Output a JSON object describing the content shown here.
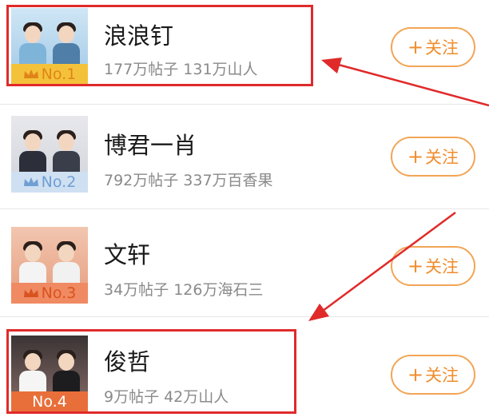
{
  "follow_label": "关注",
  "follow_plus": "+",
  "items": [
    {
      "name": "浪浪钉",
      "posts": "177万帖子",
      "followers": "131万山人",
      "rank": "No.1",
      "rank_color": "#f0a020",
      "highlighted": true
    },
    {
      "name": "博君一肖",
      "posts": "792万帖子",
      "followers": "337万百香果",
      "rank": "No.2",
      "rank_color": "#7aa6d8",
      "highlighted": false
    },
    {
      "name": "文轩",
      "posts": "34万帖子",
      "followers": "126万海石三",
      "rank": "No.3",
      "rank_color": "#e8734a",
      "highlighted": false
    },
    {
      "name": "俊哲",
      "posts": "9万帖子",
      "followers": "42万山人",
      "rank": "No.4",
      "rank_color": "#e86f3a",
      "highlighted": true
    }
  ],
  "colors": {
    "highlight_red": "#e02a2a",
    "follow_orange": "#f08c2c",
    "name_text": "#1a1a1a",
    "stats_text": "#8a8a8a"
  }
}
